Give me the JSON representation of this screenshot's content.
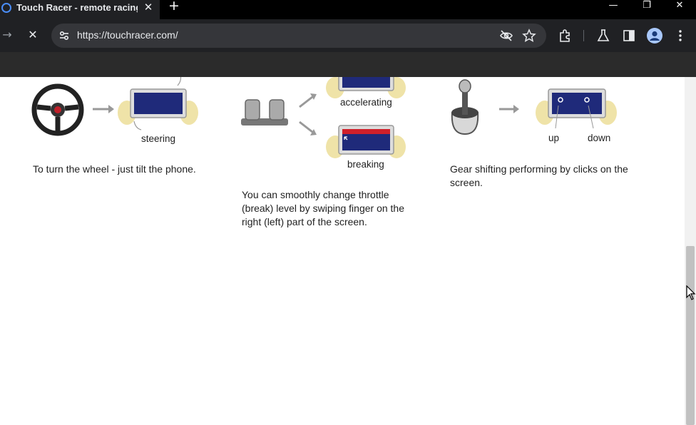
{
  "browser": {
    "tab_title": "Touch Racer - remote racing w",
    "tab_close": "✕",
    "new_tab": "+",
    "url": "https://touchracer.com/",
    "window_controls": {
      "minimize": "—",
      "restore": "❐",
      "close": "✕"
    },
    "nav": {
      "forward": "→",
      "stop": "✕"
    }
  },
  "features": [
    {
      "labels": [
        "steering"
      ],
      "description": "To turn the wheel - just tilt the phone."
    },
    {
      "labels": [
        "accelerating",
        "breaking"
      ],
      "description": "You can smoothly change throttle (break) level by swiping finger on the right (left) part of the screen."
    },
    {
      "labels": [
        "up",
        "down"
      ],
      "description": "Gear shifting performing by clicks on the screen."
    }
  ],
  "icons": {
    "site_info": "tune-icon",
    "eye_off": "eye-off-icon",
    "bookmark": "star-icon",
    "extensions": "puzzle-icon",
    "labs": "flask-icon",
    "side_panel": "side-panel-icon",
    "profile": "profile-icon",
    "menu": "kebab-menu-icon"
  },
  "colors": {
    "tabbar": "#000000",
    "toolbar": "#202124",
    "omnibox": "#35363a",
    "screen_blue": "#1f2a7a",
    "throttle_red": "#d0202a",
    "hand": "#efe3a8"
  }
}
